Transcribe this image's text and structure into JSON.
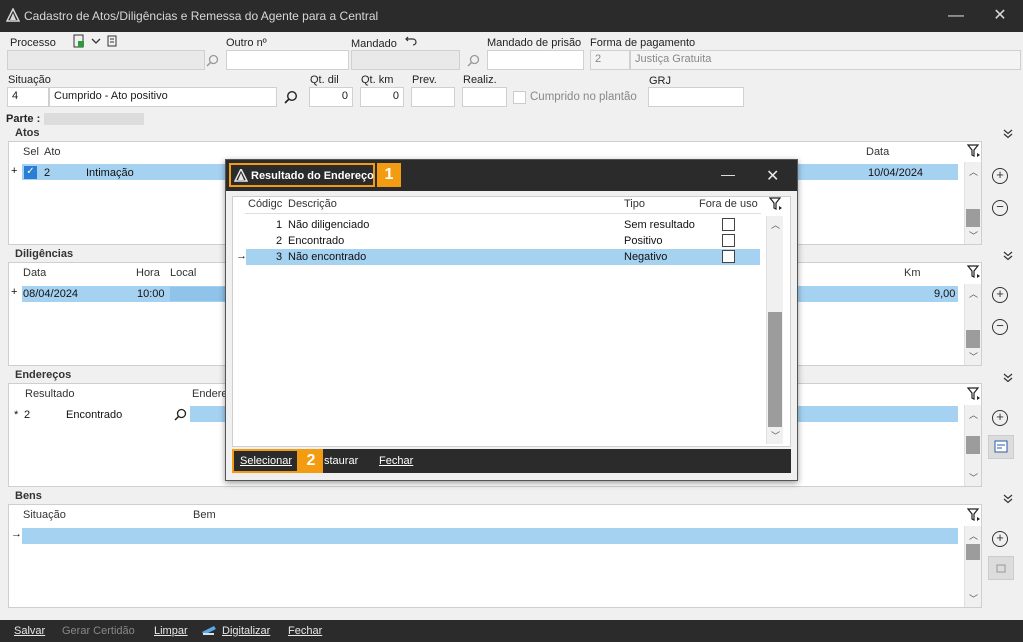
{
  "window": {
    "title": "Cadastro de Atos/Diligências e Remessa do Agente para a Central"
  },
  "header": {
    "processo_label": "Processo",
    "outro_label": "Outro nº",
    "mandado_label": "Mandado",
    "mandado_prisao_label": "Mandado de prisão",
    "forma_pagamento_label": "Forma de pagamento",
    "forma_pagamento_code": "2",
    "forma_pagamento_value": "Justiça Gratuita",
    "situacao_label": "Situação",
    "situacao_code": "4",
    "situacao_value": "Cumprido - Ato positivo",
    "qt_dil_label": "Qt. dil",
    "qt_dil_value": "0",
    "qt_km_label": "Qt. km",
    "qt_km_value": "0",
    "prev_label": "Prev.",
    "realiz_label": "Realiz.",
    "cumprido_plantao_label": "Cumprido no plantão",
    "grj_label": "GRJ",
    "parte_label": "Parte :"
  },
  "atos": {
    "title": "Atos",
    "col_sel": "Sel",
    "col_ato": "Ato",
    "col_data": "Data",
    "row": {
      "marker": "+",
      "num": "2",
      "ato": "Intimação",
      "data": "10/04/2024"
    }
  },
  "diligencias": {
    "title": "Diligências",
    "col_data": "Data",
    "col_hora": "Hora",
    "col_local": "Local",
    "col_km": "Km",
    "row": {
      "marker": "+",
      "data": "08/04/2024",
      "hora": "10:00",
      "km": "9,00"
    }
  },
  "enderecos": {
    "title": "Endereços",
    "col_resultado": "Resultado",
    "col_endereco": "Endere",
    "row": {
      "marker": "*",
      "num": "2",
      "resultado": "Encontrado"
    }
  },
  "bens": {
    "title": "Bens",
    "col_situacao": "Situação",
    "col_bem": "Bem",
    "row": {
      "marker": "→"
    }
  },
  "bottom_bar": {
    "salvar": "Salvar",
    "gerar_certidao": "Gerar Certidão",
    "limpar": "Limpar",
    "digitalizar": "Digitalizar",
    "fechar": "Fechar"
  },
  "dialog": {
    "title": "Resultado do Endereço",
    "badge1": "1",
    "badge2": "2",
    "col_codigo": "Códigc",
    "col_descricao": "Descrição",
    "col_tipo": "Tipo",
    "col_fora_uso": "Fora de uso",
    "rows": [
      {
        "codigo": "1",
        "descricao": "Não diligenciado",
        "tipo": "Sem resultado"
      },
      {
        "codigo": "2",
        "descricao": "Encontrado",
        "tipo": "Positivo"
      },
      {
        "codigo": "3",
        "descricao": "Não encontrado",
        "tipo": "Negativo",
        "selected": true
      }
    ],
    "selecionar": "Selecionar",
    "restaurar": "staurar",
    "fechar": "Fechar"
  },
  "colors": {
    "accent": "#f39c12",
    "selection": "#a6d2f2",
    "titlebar": "#2b2b2b"
  }
}
